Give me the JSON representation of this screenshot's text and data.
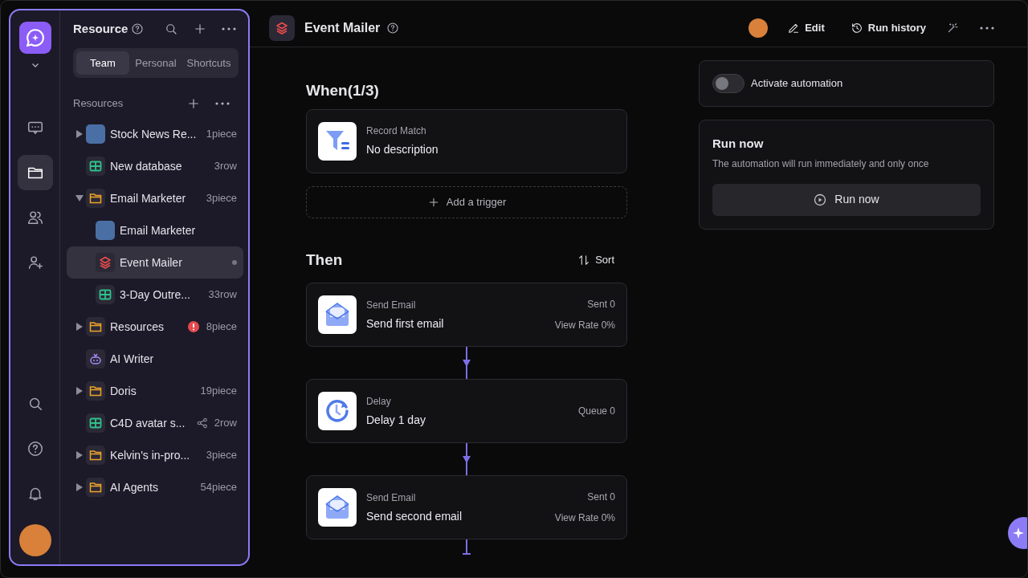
{
  "rail": {
    "top": [
      {
        "kind": "chat",
        "selected": false
      },
      {
        "kind": "folder",
        "selected": true
      },
      {
        "kind": "people",
        "selected": false
      },
      {
        "kind": "person_add",
        "selected": false
      }
    ],
    "bottom": [
      {
        "kind": "search"
      },
      {
        "kind": "help"
      },
      {
        "kind": "bell"
      }
    ]
  },
  "sidebar": {
    "title": "Resource",
    "tabs": [
      {
        "label": "Team",
        "selected": true
      },
      {
        "label": "Personal",
        "selected": false
      },
      {
        "label": "Shortcuts",
        "selected": false
      }
    ],
    "section": "Resources",
    "items": [
      {
        "kind": "avatar",
        "name": "Stock News Re...",
        "count": "1piece",
        "expanded": false,
        "selected": false
      },
      {
        "kind": "database",
        "name": "New database",
        "count": "3row",
        "selected": false
      },
      {
        "kind": "folder",
        "name": "Email Marketer",
        "count": "3piece",
        "expanded": true,
        "selected": false,
        "children": [
          {
            "kind": "avatar",
            "name": "Email Marketer",
            "selected": false
          },
          {
            "kind": "automation",
            "name": "Event Mailer",
            "selected": true
          },
          {
            "kind": "database",
            "name": "3-Day Outre...",
            "count": "33row",
            "selected": false
          }
        ]
      },
      {
        "kind": "folder",
        "name": "Resources",
        "count": "8piece",
        "expanded": false,
        "warning": true,
        "selected": false
      },
      {
        "kind": "agent",
        "name": "AI Writer",
        "selected": false
      },
      {
        "kind": "folder",
        "name": "Doris",
        "count": "19piece",
        "expanded": false,
        "selected": false
      },
      {
        "kind": "database",
        "name": "C4D avatar s...",
        "count": "2row",
        "shared": true,
        "selected": false
      },
      {
        "kind": "folder",
        "name": "Kelvin's in-pro...",
        "count": "3piece",
        "expanded": false,
        "selected": false
      },
      {
        "kind": "folder",
        "name": "AI Agents",
        "count": "54piece",
        "expanded": false,
        "selected": false
      }
    ]
  },
  "header": {
    "title": "Event Mailer",
    "actions": [
      {
        "kind": "edit",
        "label": "Edit"
      },
      {
        "kind": "history",
        "label": "Run history"
      }
    ]
  },
  "when": {
    "title": "When(1/3)",
    "triggers": [
      {
        "label": "Record Match",
        "description": "No description"
      }
    ],
    "add_label": "Add a trigger"
  },
  "then": {
    "title": "Then",
    "sort_label": "Sort",
    "steps": [
      {
        "kind": "send_email",
        "label": "Send Email",
        "description": "Send first email",
        "stats": [
          "Sent 0",
          "View Rate 0%"
        ]
      },
      {
        "kind": "delay",
        "label": "Delay",
        "description": "Delay 1 day",
        "stats": [
          "Queue 0"
        ]
      },
      {
        "kind": "send_email",
        "label": "Send Email",
        "description": "Send second email",
        "stats": [
          "Sent 0",
          "View Rate 0%"
        ]
      }
    ]
  },
  "activate": {
    "label": "Activate automation",
    "on": false
  },
  "run_now": {
    "title": "Run now",
    "description": "The automation will run immediately and only once",
    "button": "Run now"
  }
}
